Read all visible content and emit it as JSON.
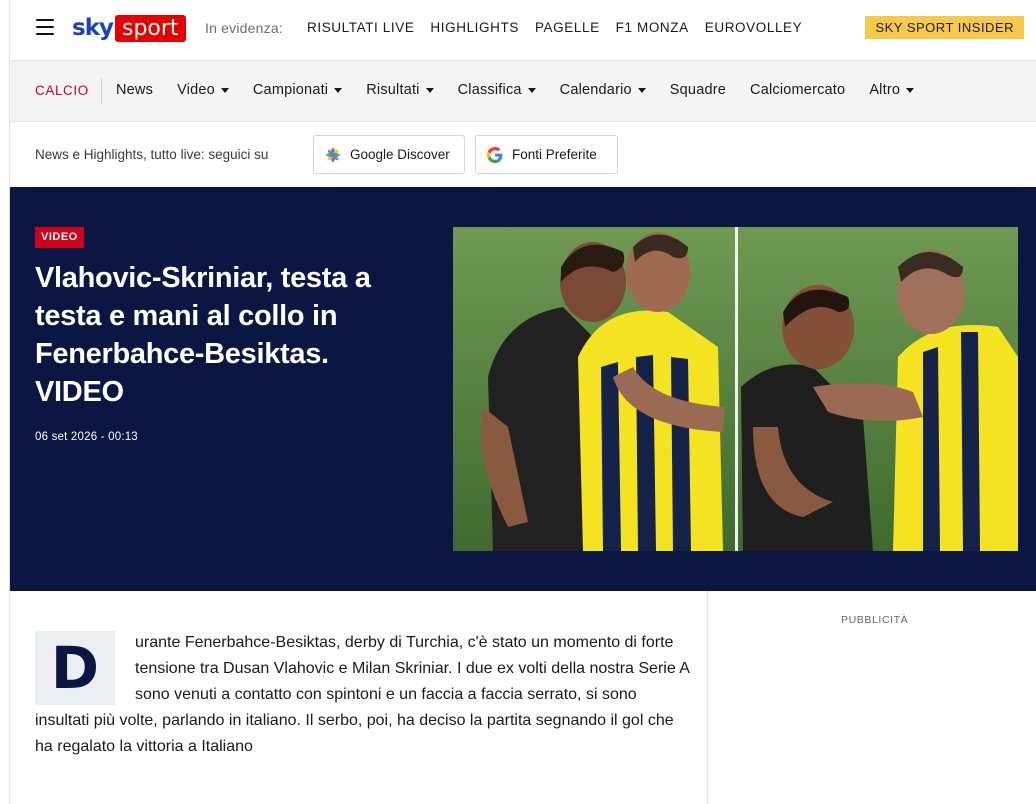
{
  "header": {
    "logo_left": "sky",
    "logo_right": "sport",
    "evidenza_label": "In evidenza:",
    "evidenza_links": [
      "RISULTATI LIVE",
      "HIGHLIGHTS",
      "PAGELLE",
      "F1 MONZA",
      "EUROVOLLEY"
    ],
    "insider_button": "SKY SPORT INSIDER"
  },
  "section_nav": {
    "section": "CALCIO",
    "items": [
      {
        "label": "News",
        "dropdown": false
      },
      {
        "label": "Video",
        "dropdown": true
      },
      {
        "label": "Campionati",
        "dropdown": true
      },
      {
        "label": "Risultati",
        "dropdown": true
      },
      {
        "label": "Classifica",
        "dropdown": true
      },
      {
        "label": "Calendario",
        "dropdown": true
      },
      {
        "label": "Squadre",
        "dropdown": false
      },
      {
        "label": "Calciomercato",
        "dropdown": false
      },
      {
        "label": "Altro",
        "dropdown": true
      }
    ]
  },
  "follow": {
    "text": "News e Highlights, tutto live: seguici su",
    "discover_label": "Google Discover",
    "fonti_label": "Fonti Preferite"
  },
  "hero": {
    "badge": "VIDEO",
    "headline": "Vlahovic-Skriniar, testa a testa e mani al collo in Fenerbahce-Besiktas. VIDEO",
    "date": "06 set 2026 - 00:13"
  },
  "article": {
    "dropcap": "D",
    "body": "urante Fenerbahce-Besiktas, derby di Turchia, c'è stato un momento di forte tensione tra Dusan Vlahovic e Milan Skriniar. I due ex volti della nostra Serie A sono venuti a contatto con spintoni e un faccia a faccia serrato, si sono insultati più volte, parlando in italiano. Il serbo, poi, ha deciso la partita segnando il gol che ha regalato la vittoria a Italiano"
  },
  "sidebar": {
    "pubblicita": "PUBBLICITÀ"
  },
  "colors": {
    "brand_blue": "#1a3fbf",
    "brand_red": "#e60000",
    "hero_bg": "#0b1642",
    "insider_yellow": "#f7c948",
    "section_red": "#d0021b"
  }
}
